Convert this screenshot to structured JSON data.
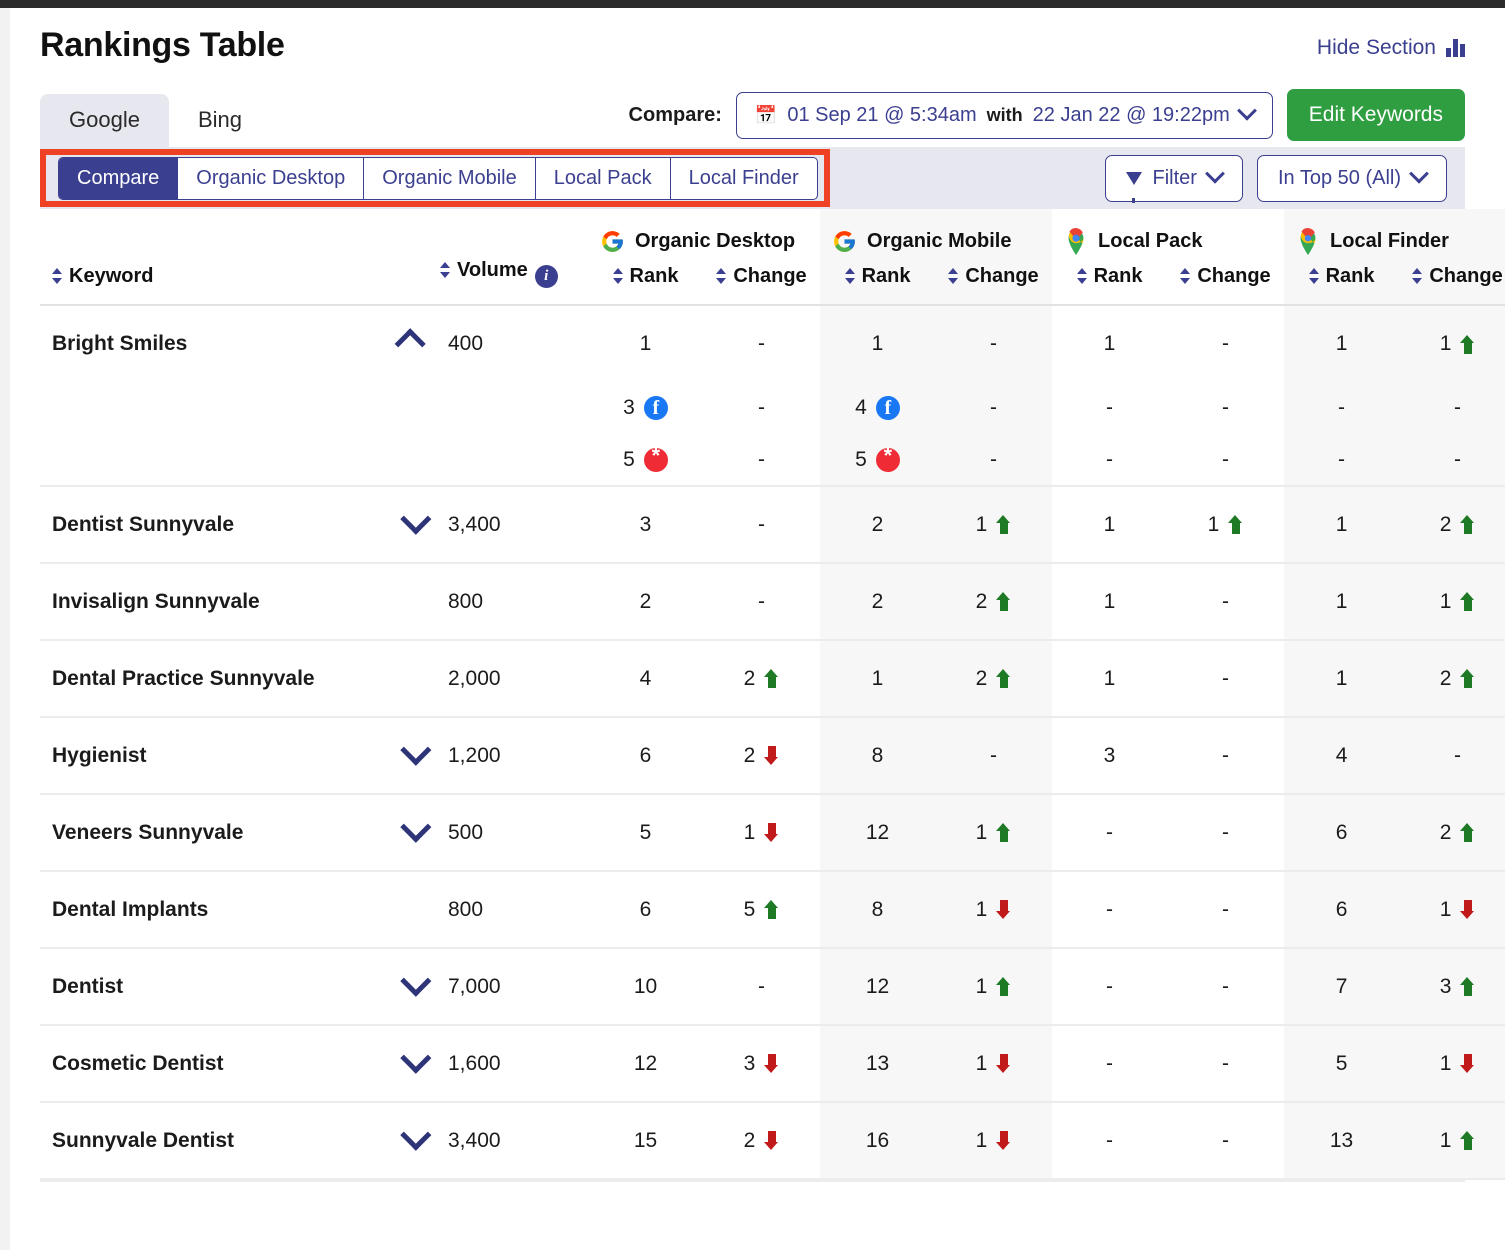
{
  "header": {
    "title": "Rankings Table",
    "hide_section_label": "Hide Section",
    "chart_icon": "bar-chart-icon"
  },
  "engine_tabs": [
    {
      "label": "Google",
      "active": true
    },
    {
      "label": "Bing",
      "active": false
    }
  ],
  "compare": {
    "label": "Compare:",
    "calendar_icon": "calendar-icon",
    "date_from": "01 Sep 21 @ 5:34am",
    "with_label": "with",
    "date_to": "22 Jan 22 @ 19:22pm",
    "chevron_icon": "chevron-down-icon",
    "edit_keywords_label": "Edit Keywords"
  },
  "sub_tabs": [
    {
      "label": "Compare",
      "active": true
    },
    {
      "label": "Organic Desktop",
      "active": false
    },
    {
      "label": "Organic Mobile",
      "active": false
    },
    {
      "label": "Local Pack",
      "active": false
    },
    {
      "label": "Local Finder",
      "active": false
    }
  ],
  "controls": {
    "filter_label": "Filter",
    "filter_icon": "funnel-icon",
    "top_filter_label": "In Top 50 (All)",
    "chevron_icon": "chevron-down-icon"
  },
  "table": {
    "col_keyword": "Keyword",
    "col_volume": "Volume",
    "volume_info_icon": "info-icon",
    "groups": [
      {
        "name": "Organic Desktop",
        "icon": "google-g-icon",
        "shaded": false
      },
      {
        "name": "Organic Mobile",
        "icon": "google-g-icon",
        "shaded": true
      },
      {
        "name": "Local Pack",
        "icon": "google-maps-pin-icon",
        "shaded": false
      },
      {
        "name": "Local Finder",
        "icon": "google-maps-pin-icon",
        "shaded": true
      }
    ],
    "col_rank": "Rank",
    "col_change": "Change",
    "rows": [
      {
        "keyword": "Bright Smiles",
        "toggle": "up",
        "volume": "400",
        "od_rank": "1",
        "od_change": "-",
        "od_dir": "none",
        "om_rank": "1",
        "om_change": "-",
        "om_dir": "none",
        "lp_rank": "1",
        "lp_change": "-",
        "lp_dir": "none",
        "lf_rank": "1",
        "lf_change": "1",
        "lf_dir": "up",
        "subrows": [
          {
            "od_rank": "3",
            "od_icon": "facebook-icon",
            "od_change": "-",
            "od_dir": "none",
            "om_rank": "4",
            "om_icon": "facebook-icon",
            "om_change": "-",
            "om_dir": "none",
            "lp_rank": "-",
            "lp_icon": "",
            "lp_change": "-",
            "lp_dir": "none",
            "lf_rank": "-",
            "lf_icon": "",
            "lf_change": "-",
            "lf_dir": "none"
          },
          {
            "od_rank": "5",
            "od_icon": "yelp-icon",
            "od_change": "-",
            "od_dir": "none",
            "om_rank": "5",
            "om_icon": "yelp-icon",
            "om_change": "-",
            "om_dir": "none",
            "lp_rank": "-",
            "lp_icon": "",
            "lp_change": "-",
            "lp_dir": "none",
            "lf_rank": "-",
            "lf_icon": "",
            "lf_change": "-",
            "lf_dir": "none"
          }
        ]
      },
      {
        "keyword": "Dentist Sunnyvale",
        "toggle": "down",
        "volume": "3,400",
        "od_rank": "3",
        "od_change": "-",
        "od_dir": "none",
        "om_rank": "2",
        "om_change": "1",
        "om_dir": "up",
        "lp_rank": "1",
        "lp_change": "1",
        "lp_dir": "up",
        "lf_rank": "1",
        "lf_change": "2",
        "lf_dir": "up",
        "subrows": []
      },
      {
        "keyword": "Invisalign Sunnyvale",
        "toggle": "none",
        "volume": "800",
        "od_rank": "2",
        "od_change": "-",
        "od_dir": "none",
        "om_rank": "2",
        "om_change": "2",
        "om_dir": "up",
        "lp_rank": "1",
        "lp_change": "-",
        "lp_dir": "none",
        "lf_rank": "1",
        "lf_change": "1",
        "lf_dir": "up",
        "subrows": []
      },
      {
        "keyword": "Dental Practice Sunnyvale",
        "toggle": "none",
        "volume": "2,000",
        "od_rank": "4",
        "od_change": "2",
        "od_dir": "up",
        "om_rank": "1",
        "om_change": "2",
        "om_dir": "up",
        "lp_rank": "1",
        "lp_change": "-",
        "lp_dir": "none",
        "lf_rank": "1",
        "lf_change": "2",
        "lf_dir": "up",
        "subrows": []
      },
      {
        "keyword": "Hygienist",
        "toggle": "down",
        "volume": "1,200",
        "od_rank": "6",
        "od_change": "2",
        "od_dir": "down",
        "om_rank": "8",
        "om_change": "-",
        "om_dir": "none",
        "lp_rank": "3",
        "lp_change": "-",
        "lp_dir": "none",
        "lf_rank": "4",
        "lf_change": "-",
        "lf_dir": "none",
        "subrows": []
      },
      {
        "keyword": "Veneers Sunnyvale",
        "toggle": "down",
        "volume": "500",
        "od_rank": "5",
        "od_change": "1",
        "od_dir": "down",
        "om_rank": "12",
        "om_change": "1",
        "om_dir": "up",
        "lp_rank": "-",
        "lp_change": "-",
        "lp_dir": "none",
        "lf_rank": "6",
        "lf_change": "2",
        "lf_dir": "up",
        "subrows": []
      },
      {
        "keyword": "Dental Implants",
        "toggle": "none",
        "volume": "800",
        "od_rank": "6",
        "od_change": "5",
        "od_dir": "up",
        "om_rank": "8",
        "om_change": "1",
        "om_dir": "down",
        "lp_rank": "-",
        "lp_change": "-",
        "lp_dir": "none",
        "lf_rank": "6",
        "lf_change": "1",
        "lf_dir": "down",
        "subrows": []
      },
      {
        "keyword": "Dentist",
        "toggle": "down",
        "volume": "7,000",
        "od_rank": "10",
        "od_change": "-",
        "od_dir": "none",
        "om_rank": "12",
        "om_change": "1",
        "om_dir": "up",
        "lp_rank": "-",
        "lp_change": "-",
        "lp_dir": "none",
        "lf_rank": "7",
        "lf_change": "3",
        "lf_dir": "up",
        "subrows": []
      },
      {
        "keyword": "Cosmetic Dentist",
        "toggle": "down",
        "volume": "1,600",
        "od_rank": "12",
        "od_change": "3",
        "od_dir": "down",
        "om_rank": "13",
        "om_change": "1",
        "om_dir": "down",
        "lp_rank": "-",
        "lp_change": "-",
        "lp_dir": "none",
        "lf_rank": "5",
        "lf_change": "1",
        "lf_dir": "down",
        "subrows": []
      },
      {
        "keyword": "Sunnyvale Dentist",
        "toggle": "down",
        "volume": "3,400",
        "od_rank": "15",
        "od_change": "2",
        "od_dir": "down",
        "om_rank": "16",
        "om_change": "1",
        "om_dir": "down",
        "lp_rank": "-",
        "lp_change": "-",
        "lp_dir": "none",
        "lf_rank": "13",
        "lf_change": "1",
        "lf_dir": "up",
        "subrows": []
      }
    ]
  },
  "colors": {
    "brand_navy": "#3b3f8f",
    "accent_green": "#2f9e41",
    "up_green": "#1e7a24",
    "down_red": "#c01a1a",
    "highlight_red": "#ef4123",
    "tab_bg": "#e7e7ef"
  }
}
